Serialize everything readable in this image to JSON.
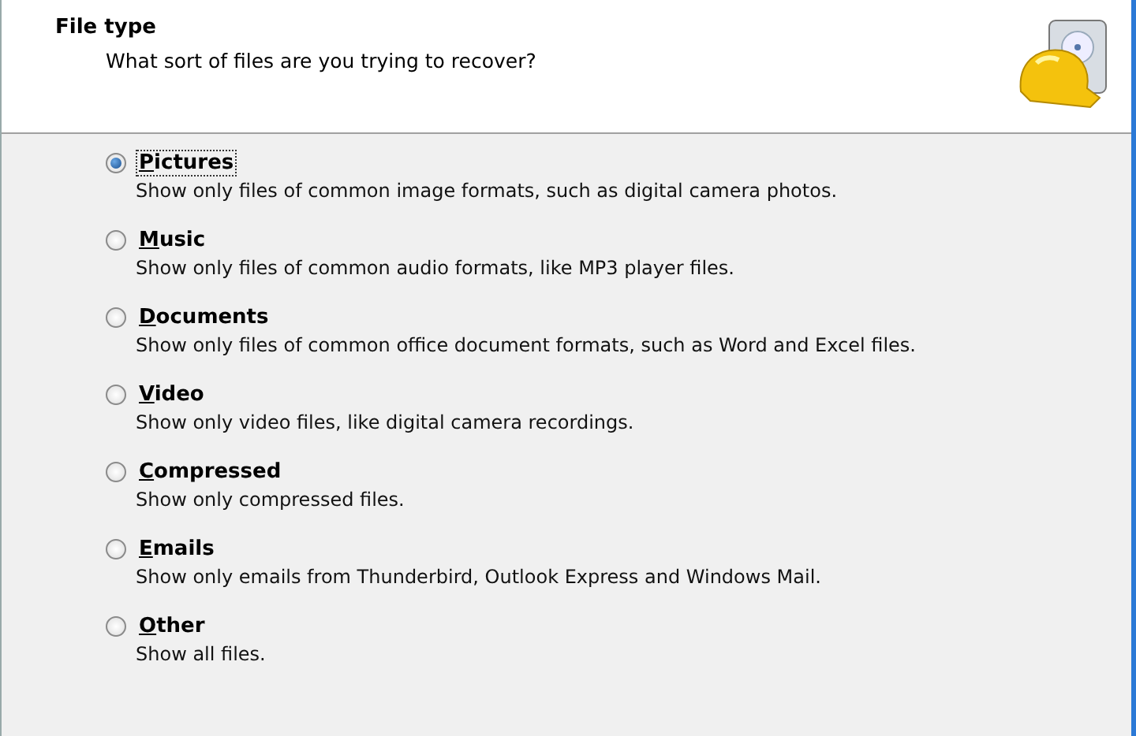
{
  "header": {
    "title": "File type",
    "subtitle": "What sort of files are you trying to recover?"
  },
  "options": [
    {
      "label": "Pictures",
      "description": "Show only files of common image formats, such as digital camera photos.",
      "selected": true,
      "focused": true
    },
    {
      "label": "Music",
      "description": "Show only files of common audio formats, like MP3 player files.",
      "selected": false,
      "focused": false
    },
    {
      "label": "Documents",
      "description": "Show only files of common office document formats, such as Word and Excel files.",
      "selected": false,
      "focused": false
    },
    {
      "label": "Video",
      "description": "Show only video files, like digital camera recordings.",
      "selected": false,
      "focused": false
    },
    {
      "label": "Compressed",
      "description": "Show only compressed files.",
      "selected": false,
      "focused": false
    },
    {
      "label": "Emails",
      "description": "Show only emails from Thunderbird, Outlook Express and Windows Mail.",
      "selected": false,
      "focused": false
    },
    {
      "label": "Other",
      "description": "Show all files.",
      "selected": false,
      "focused": false
    }
  ]
}
